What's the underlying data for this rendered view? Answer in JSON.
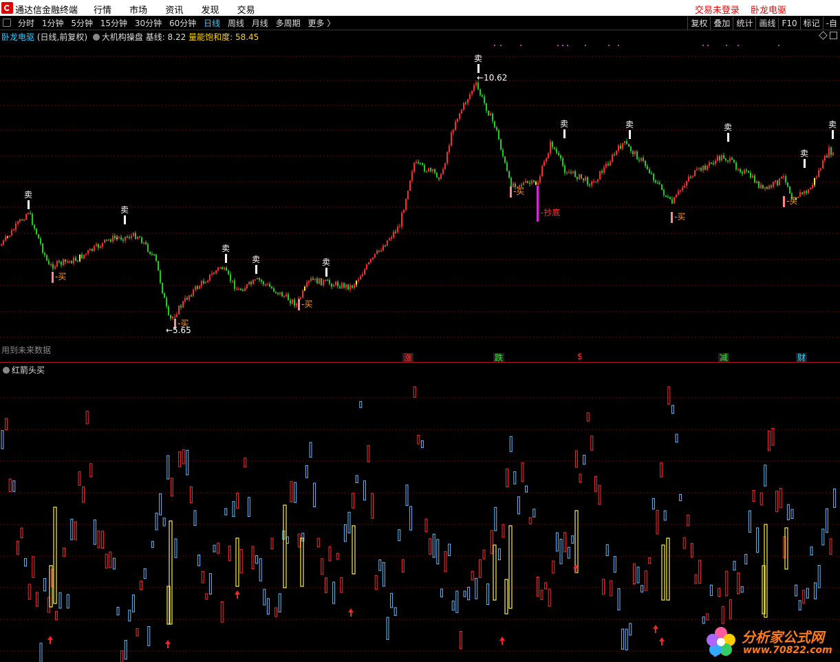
{
  "titlebar": {
    "app_title": "通达信金融终端",
    "menu": [
      "行情",
      "市场",
      "资讯",
      "发现",
      "交易"
    ],
    "right": [
      "交易未登录",
      "卧龙电驱"
    ]
  },
  "toolbar": {
    "periods": [
      "分时",
      "1分钟",
      "5分钟",
      "15分钟",
      "30分钟",
      "60分钟",
      "日线",
      "周线",
      "月线",
      "多周期",
      "更多 〉"
    ],
    "active_period": "日线",
    "tools": [
      "复权",
      "叠加",
      "统计",
      "画线",
      "F10",
      "标记",
      "-自"
    ]
  },
  "main_chart": {
    "stock": "卧龙电驱",
    "mode": "(日线,前复权)",
    "indicator": "大机构操盘",
    "baseline_label": "基线: 8.22",
    "saturation_label": "量能饱和度: 58.45",
    "high_label": "10.62",
    "low_label": "5.65",
    "future_note": "用到未来数据",
    "sell_label": "卖",
    "buy_label": "买",
    "bottom_label": "抄底"
  },
  "markers": [
    {
      "text": "涨",
      "color": "#ff3333",
      "bg": "#222"
    },
    {
      "text": "跌",
      "color": "#33ee33",
      "bg": "#222"
    },
    {
      "text": "$",
      "color": "#ff3333",
      "bg": "#000"
    },
    {
      "text": "减",
      "color": "#33ee33",
      "bg": "#222"
    },
    {
      "text": "财",
      "color": "#33ccff",
      "bg": "#222"
    }
  ],
  "sub_chart": {
    "title": "红箭头买"
  },
  "watermark": {
    "line1": "分析家公式网",
    "line2": "www.70822.com"
  },
  "colors": {
    "up": "#ff2a2a",
    "down": "#22cc22",
    "signal": "#ffee33",
    "grid": "#7a0000",
    "subup": "#ff2a2a",
    "subdown": "#66bbff"
  }
}
